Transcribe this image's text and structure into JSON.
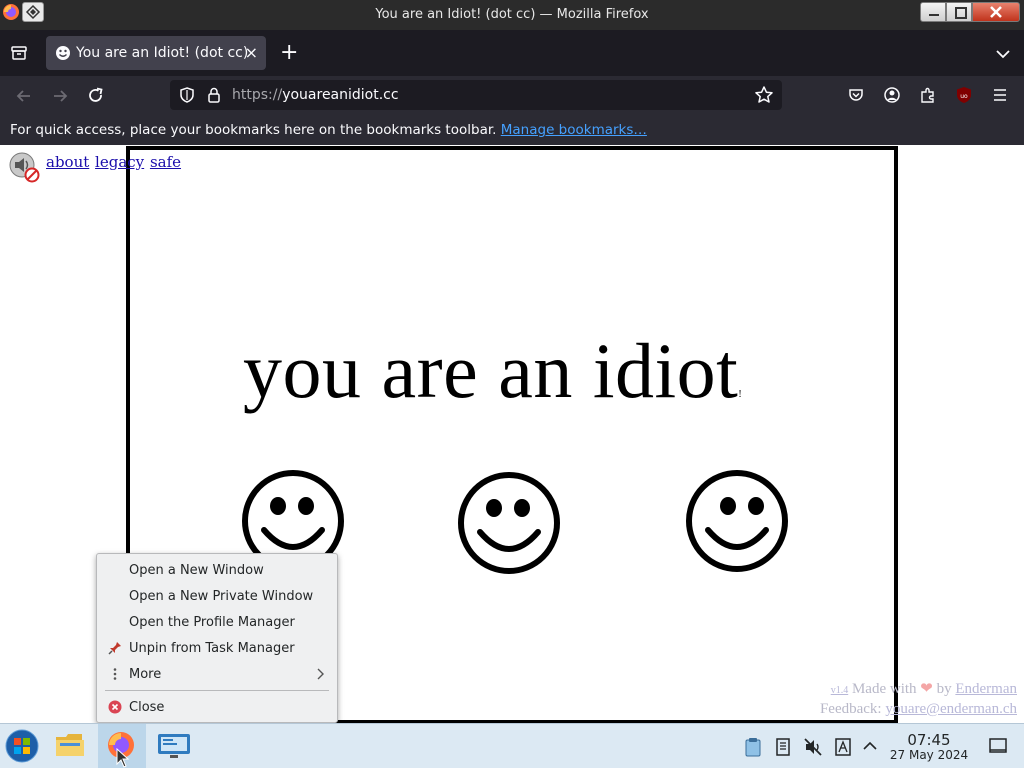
{
  "window": {
    "title": "You are an Idiot! (dot cc) — Mozilla Firefox"
  },
  "tab": {
    "label": "You are an Idiot! (dot cc)",
    "close_glyph": "×",
    "new_tab_glyph": "+"
  },
  "nav": {
    "url_protocol": "https://",
    "url_host": "youareanidiot.cc"
  },
  "bookmarks_bar": {
    "message": "For quick access, place your bookmarks here on the bookmarks toolbar.",
    "link": "Manage bookmarks…"
  },
  "page": {
    "links": [
      "about",
      "legacy",
      "safe"
    ],
    "headline": "you are an idiot",
    "headline_mark": "!",
    "footer": {
      "version": "v1.4",
      "made_with": "Made with",
      "heart": "❤",
      "by": "by",
      "author": "Enderman",
      "feedback_label": "Feedback:",
      "feedback_email": "youare@enderman.ch"
    }
  },
  "context_menu": {
    "items": [
      {
        "label": "Open a New Window",
        "icon": null
      },
      {
        "label": "Open a New Private Window",
        "icon": null
      },
      {
        "label": "Open the Profile Manager",
        "icon": null
      },
      {
        "label": "Unpin from Task Manager",
        "icon": "unpin-icon"
      },
      {
        "label": "More",
        "icon": "more-icon",
        "submenu": true
      },
      {
        "label": "Close",
        "icon": "close-icon"
      }
    ]
  },
  "taskbar": {
    "time": "07:45",
    "date": "27 May 2024"
  },
  "colors": {
    "titlebar": "#2b2b2b",
    "tabbar": "#1c1b22",
    "navbar": "#2b2a33",
    "link": "#45a1ff",
    "taskbar": "#dce9f3",
    "ublock": "#800000"
  }
}
